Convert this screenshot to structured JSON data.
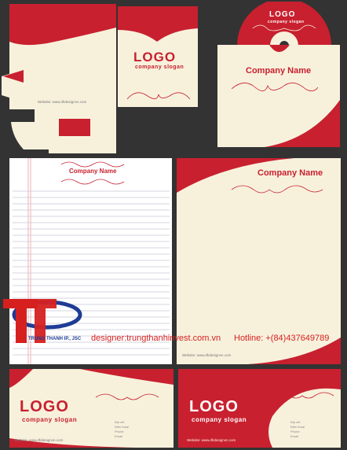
{
  "colors": {
    "background": "#333333",
    "brand_red": "#c8202f",
    "paper": "#f7f1dc",
    "hotline_red": "#d62020"
  },
  "folder": {
    "logo": "LOGO",
    "slogan": "company slogan",
    "website": "Website: www.dhdesignvn.com"
  },
  "cd": {
    "logo": "LOGO",
    "slogan": "company slogan"
  },
  "cd_sleeve": {
    "company_name": "Company Name"
  },
  "letterhead_lined": {
    "company_name": "Company Name"
  },
  "letterhead": {
    "company_name": "Company Name",
    "website": "Website: www.dhdesignvn.com"
  },
  "watermark": {
    "company": "TRUNG THANH IP., JSC",
    "designer": "designer:trungthanhinvest.com.vn",
    "hotline": "Hotline: +(84)437649789"
  },
  "card_left": {
    "logo": "LOGO",
    "slogan": "company slogan",
    "website": "Website: www.dhdesignvn.com",
    "contact": [
      "Địa chỉ",
      "Điện thoại",
      "Phone",
      "Email"
    ]
  },
  "card_right": {
    "logo": "LOGO",
    "slogan": "company slogan",
    "website": "Website: www.dhdesignvn.com",
    "contact": [
      "Địa chỉ",
      "Điện thoại",
      "Phone",
      "Email"
    ]
  }
}
